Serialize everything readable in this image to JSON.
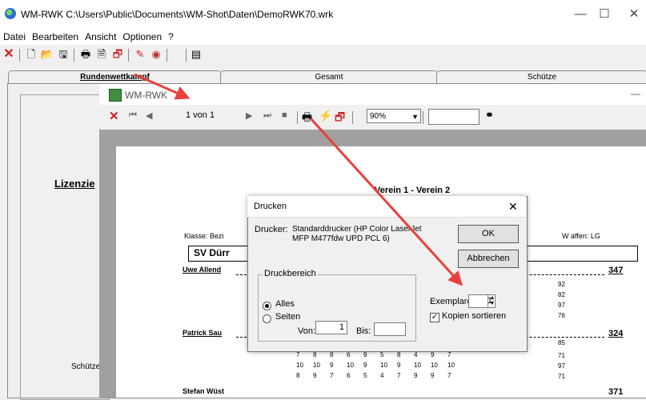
{
  "main_window": {
    "title": "WM-RWK C:\\Users\\Public\\Documents\\WM-Shot\\Daten\\DemoRWK70.wrk",
    "controls": {
      "minimize": "—",
      "maximize": "☐",
      "close": "✕"
    }
  },
  "menu": [
    "Datei",
    "Bearbeiten",
    "Ansicht",
    "Optionen",
    "?"
  ],
  "tabs": [
    "Rundenwettkampf",
    "Gesamt",
    "Schütze"
  ],
  "labels": {
    "lizenz": "Lizenzie",
    "schuetze": "Schütze"
  },
  "preview_window": {
    "title": "WM-RWK",
    "minimize": "—",
    "page_indicator": "1 von 1",
    "zoom": "90%"
  },
  "report": {
    "title": "Verein 1 - Verein 2",
    "klasse": "Klasse: Bezi",
    "waffen": "W affen: LG",
    "team": "SV Dürr",
    "shooters": [
      {
        "name": "Uwe Allend",
        "total": "347",
        "scores": [
          "92",
          "82",
          "97",
          "76"
        ]
      },
      {
        "name": "Patrick Sau",
        "total": "324",
        "scores": [
          "85",
          "71",
          "97",
          "71"
        ]
      },
      {
        "name": "Stefan Wüst",
        "total": "371"
      }
    ],
    "rows": [
      [
        "7",
        "8",
        "8",
        "6",
        "9",
        "5",
        "8",
        "4",
        "9",
        "7"
      ],
      [
        "10",
        "10",
        "9",
        "10",
        "9",
        "10",
        "9",
        "10",
        "10",
        "10"
      ],
      [
        "8",
        "9",
        "7",
        "6",
        "5",
        "4",
        "7",
        "9",
        "9",
        "7"
      ]
    ]
  },
  "print_dialog": {
    "title": "Drucken",
    "close": "✕",
    "printer_label": "Drucker:",
    "printer_name_line1": "Standarddrucker (HP Color LaserJet",
    "printer_name_line2": "MFP M477fdw UPD PCL 6)",
    "ok": "OK",
    "cancel": "Abbrechen",
    "range_label": "Druckbereich",
    "all": "Alles",
    "pages": "Seiten",
    "from": "Von:",
    "from_value": "1",
    "to": "Bis:",
    "to_value": "",
    "copies_label": "Exemplare:",
    "copies_value": "1",
    "sort_label": "Kopien sortieren",
    "range_selected": "Alles",
    "sort_checked": true
  },
  "icons": {
    "close": "close-icon",
    "new": "new-file-icon",
    "open": "open-folder-icon",
    "save": "save-icon",
    "print": "printer-icon",
    "preview": "print-preview-icon",
    "export": "export-icon",
    "binoculars": "binoculars-icon"
  },
  "colors": {
    "arrow": "#e8413c",
    "accent_link": "#0066cc"
  }
}
